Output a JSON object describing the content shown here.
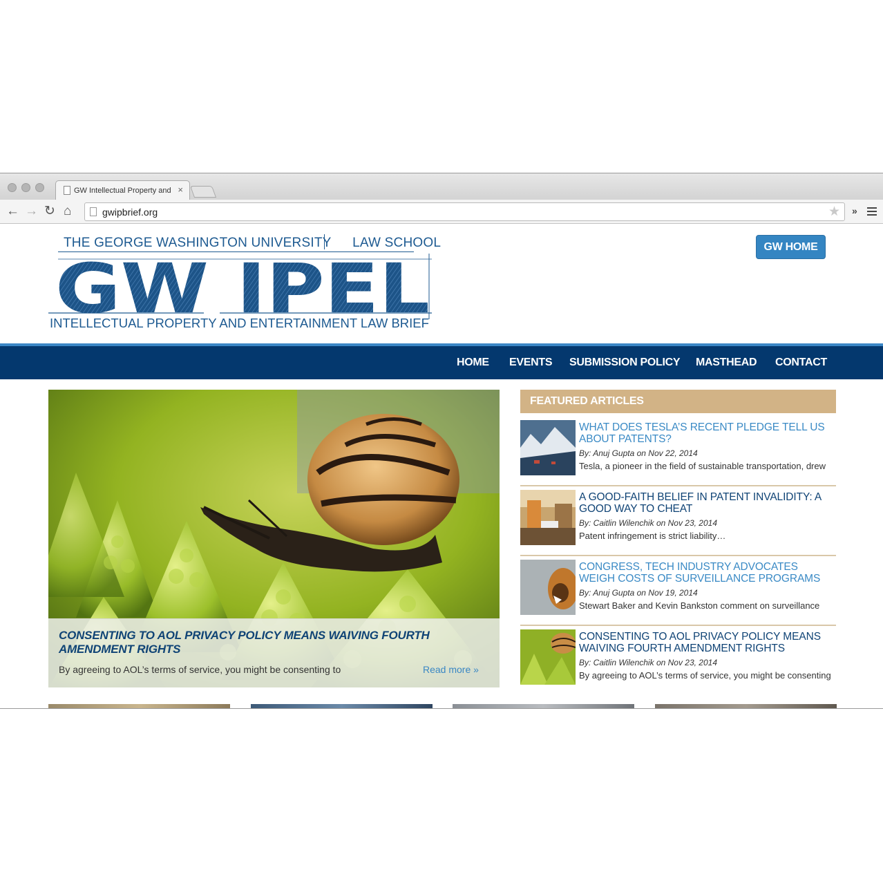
{
  "browser": {
    "tab_title": "GW Intellectual Property and Entertainment Law Brief",
    "tab_close": "×",
    "url": "gwipbrief.org",
    "ext_chevron": "»"
  },
  "site": {
    "logo_top_left": "THE GEORGE WASHINGTON UNIVERSITY",
    "logo_top_right": "LAW SCHOOL",
    "logo_main": "GW IPEL",
    "logo_bottom": "INTELLECTUAL PROPERTY AND ENTERTAINMENT LAW BRIEF",
    "gw_home_label": "GW HOME"
  },
  "nav": {
    "items": [
      "HOME",
      "EVENTS",
      "SUBMISSION POLICY",
      "MASTHEAD",
      "CONTACT"
    ]
  },
  "hero": {
    "title": "CONSENTING TO AOL PRIVACY POLICY MEANS WAIVING FOURTH AMENDMENT RIGHTS",
    "excerpt": "By agreeing to AOL’s terms of service, you might be consenting to",
    "read_more": "Read more »"
  },
  "featured": {
    "header": "FEATURED ARTICLES",
    "items": [
      {
        "title": "WHAT DOES TESLA’S RECENT PLEDGE TELL US ABOUT PATENTS?",
        "by": "By: Anuj Gupta",
        "date": "on Nov 22, 2014",
        "excerpt": "Tesla, a pioneer in the field of sustainable transportation, drew"
      },
      {
        "title": "A GOOD-FAITH BELIEF IN PATENT INVALIDITY: A GOOD WAY TO CHEAT",
        "by": "By: Caitlin Wilenchik",
        "date": "on Nov 23, 2014",
        "excerpt": "Patent infringement is strict liability…"
      },
      {
        "title": "CONGRESS, TECH INDUSTRY ADVOCATES WEIGH COSTS OF SURVEILLANCE PROGRAMS",
        "by": "By: Anuj Gupta",
        "date": "on Nov 19, 2014",
        "excerpt": "Stewart Baker and Kevin Bankston comment on surveillance"
      },
      {
        "title": "CONSENTING TO AOL PRIVACY POLICY MEANS WAIVING FOURTH AMENDMENT RIGHTS",
        "by": "By: Caitlin Wilenchik",
        "date": "on Nov 23, 2014",
        "excerpt": "By agreeing to AOL’s terms of service, you might be consenting"
      }
    ]
  },
  "colors": {
    "nav_bg": "#04386e",
    "accent_blue": "#3485c2",
    "featured_tan": "#d2b386",
    "link_blue": "#3a8ac5",
    "title_navy": "#0f4375"
  }
}
